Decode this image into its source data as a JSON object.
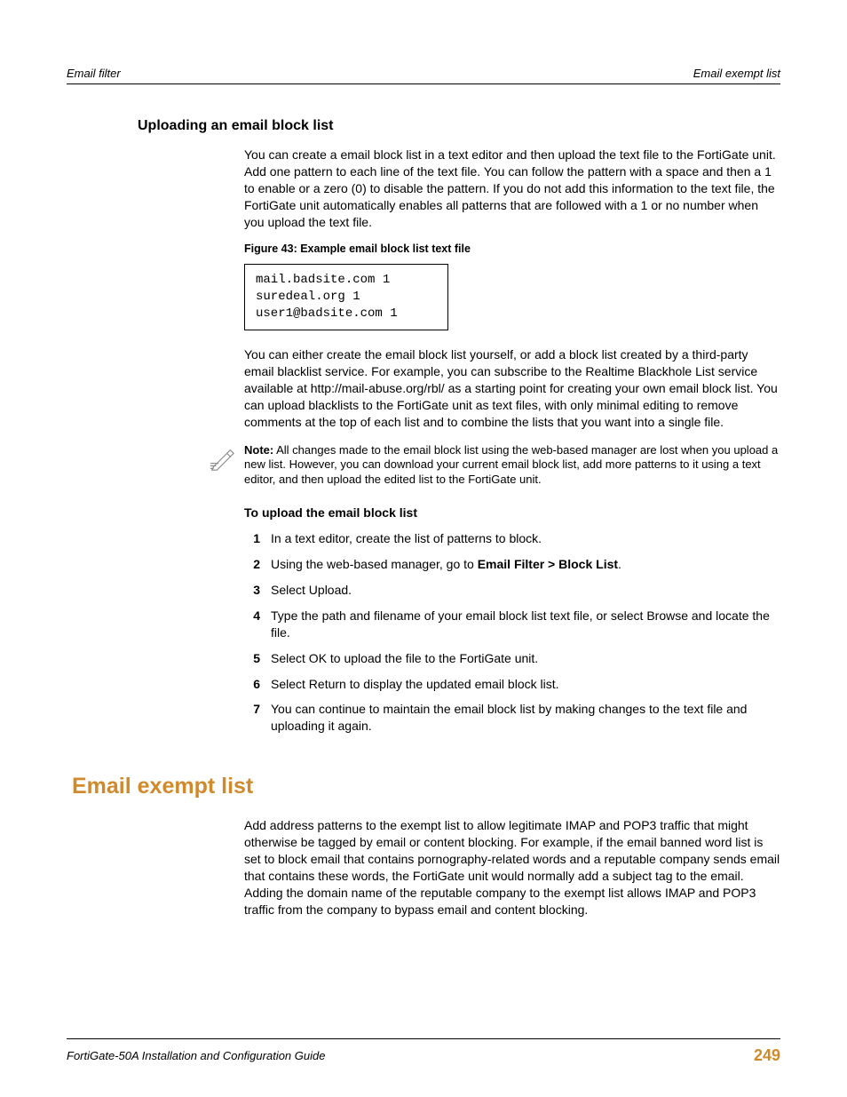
{
  "header": {
    "left": "Email filter",
    "right": "Email exempt list"
  },
  "section1": {
    "heading": "Uploading an email block list",
    "para1": "You can create a email block list in a text editor and then upload the text file to the FortiGate unit. Add one pattern to each line of the text file. You can follow the pattern with a space and then a 1 to enable or a zero (0) to disable the pattern. If you do not add this information to the text file, the FortiGate unit automatically enables all patterns that are followed with a 1 or no number when you upload the text file.",
    "figureCaption": "Figure 43: Example email block list text file",
    "code": "mail.badsite.com 1\nsuredeal.org 1\nuser1@badsite.com 1",
    "para2": "You can either create the email block list yourself, or add a block list created by a third-party email blacklist service. For example, you can subscribe to the Realtime Blackhole List service available at http://mail-abuse.org/rbl/ as a starting point for creating your own email block list. You can upload blacklists to the FortiGate unit as text files, with only minimal editing to remove comments at the top of each list and to combine the lists that you want into a single file.",
    "noteLabel": "Note:",
    "noteText": " All changes made to the email block list using the web-based manager are lost when you upload a new list. However, you can download your current email block list, add more patterns to it using a text editor, and then upload the edited list to the FortiGate unit.",
    "uploadHeading": "To upload the email block list",
    "steps": [
      "In a text editor, create the list of patterns to block.",
      "Using the web-based manager, go to ",
      "Select Upload.",
      "Type the path and filename of your email block list text file, or select Browse and locate the file.",
      "Select OK to upload the file to the FortiGate unit.",
      "Select Return to display the updated email block list.",
      "You can continue to maintain the email block list by making changes to the text file and uploading it again."
    ],
    "step2Bold": "Email Filter > Block List",
    "step2After": "."
  },
  "major": {
    "heading": "Email exempt list",
    "para": "Add address patterns to the exempt list to allow legitimate IMAP and POP3 traffic that might otherwise be tagged by email or content blocking. For example, if the email banned word list is set to block email that contains pornography-related words and a reputable company sends email that contains these words, the FortiGate unit would normally add a subject tag to the email. Adding the domain name of the reputable company to the exempt list allows IMAP and POP3 traffic from the company to bypass email and content blocking."
  },
  "footer": {
    "left": "FortiGate-50A Installation and Configuration Guide",
    "page": "249"
  }
}
